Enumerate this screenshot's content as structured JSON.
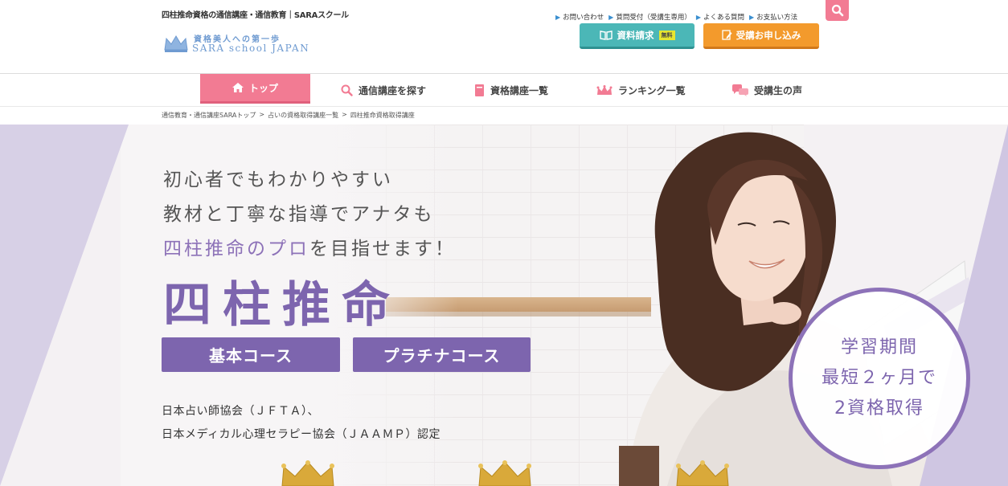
{
  "header": {
    "tagline": "四柱推命資格の通信講座・通信教育｜SARAスクール",
    "logo_line1": "資格美人への第一歩",
    "logo_line2": "SARA school JAPAN",
    "utility_links": [
      {
        "label": "お問い合わせ"
      },
      {
        "label": "質問受付（受講生専用）"
      },
      {
        "label": "よくある質問"
      },
      {
        "label": "お支払い方法"
      }
    ],
    "request_button": {
      "label": "資料請求",
      "badge": "無料"
    },
    "apply_button": {
      "label": "受講お申し込み"
    }
  },
  "nav": {
    "items": [
      {
        "label": "トップ"
      },
      {
        "label": "通信講座を探す"
      },
      {
        "label": "資格講座一覧"
      },
      {
        "label": "ランキング一覧"
      },
      {
        "label": "受講生の声"
      }
    ]
  },
  "breadcrumb": [
    {
      "label": "通信教育・通信講座SARAトップ"
    },
    {
      "label": "占いの資格取得講座一覧"
    },
    {
      "label": "四柱推命資格取得講座"
    }
  ],
  "breadcrumb_sep": ">",
  "hero": {
    "copy_line1": "初心者でもわかりやすい",
    "copy_line2": "教材と丁寧な指導でアナタも",
    "copy_line3_accent": "四柱推命のプロ",
    "copy_line3_rest": "を目指せます！",
    "title": "四柱推命",
    "course_basic": "基本コース",
    "course_platinum": "プラチナコース",
    "assoc_line1": "日本占い師協会（ＪＦＴＡ）、",
    "assoc_line2": "日本メディカル心理セラピー協会（ＪＡＡＭＰ）認定",
    "badge_line1": "学習期間",
    "badge_line2": "最短２ヶ月で",
    "badge_line3": "2資格取得"
  },
  "colors": {
    "pink": "#f27b93",
    "teal": "#4bb7b7",
    "orange": "#f39a2c",
    "purple": "#7d65ae",
    "lavender": "#d7d0e6"
  },
  "icons": [
    "search-icon",
    "book-icon",
    "pen-icon",
    "home-icon",
    "magnifier-icon",
    "notebook-icon",
    "crown-icon",
    "chat-icon"
  ]
}
